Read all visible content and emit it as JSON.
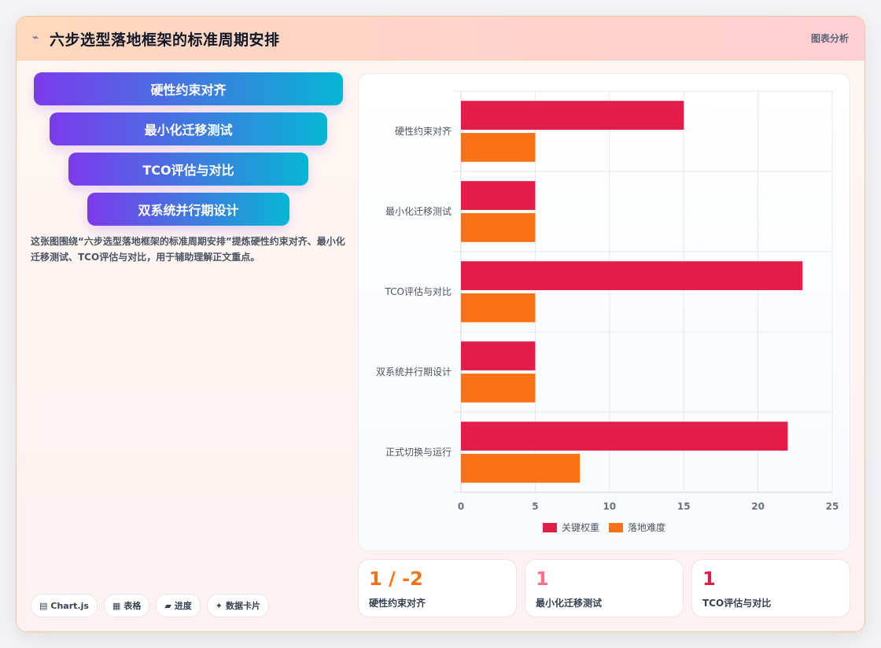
{
  "header": {
    "icon": "chart-line-icon",
    "title": "六步选型落地框架的标准周期安排",
    "action_label": "图表分析"
  },
  "funnel": {
    "steps": [
      "硬性约束对齐",
      "最小化迁移测试",
      "TCO评估与对比",
      "双系统并行期设计"
    ]
  },
  "description": "这张图围绕“六步选型落地框架的标准周期安排”提炼硬性约束对齐、最小化迁移测试、TCO评估与对比，用于辅助理解正文重点。",
  "tags": [
    {
      "icon": "chart-icon",
      "label": "Chart.js"
    },
    {
      "icon": "table-icon",
      "label": "表格"
    },
    {
      "icon": "progress-icon",
      "label": "进度"
    },
    {
      "icon": "sparkle-icon",
      "label": "数据卡片"
    }
  ],
  "stats": [
    {
      "value": "1 / -2",
      "label": "硬性约束对齐",
      "color": "#f97316"
    },
    {
      "value": "1",
      "label": "最小化迁移测试",
      "color": "#f87186"
    },
    {
      "value": "1",
      "label": "TCO评估与对比",
      "color": "#e11d48"
    }
  ],
  "chart_data": {
    "type": "bar",
    "orientation": "horizontal",
    "categories": [
      "硬性约束对齐",
      "最小化迁移测试",
      "TCO评估与对比",
      "双系统并行期设计",
      "正式切换与运行"
    ],
    "series": [
      {
        "name": "关键权重",
        "color": "#e11d48",
        "values": [
          15,
          5,
          23,
          5,
          22
        ]
      },
      {
        "name": "落地难度",
        "color": "#f97316",
        "values": [
          5,
          5,
          5,
          5,
          8
        ]
      }
    ],
    "xlim": [
      0,
      25
    ],
    "xticks": [
      "0",
      "5",
      "10",
      "15",
      "20",
      "25"
    ],
    "grid": true,
    "legend_position": "bottom"
  }
}
